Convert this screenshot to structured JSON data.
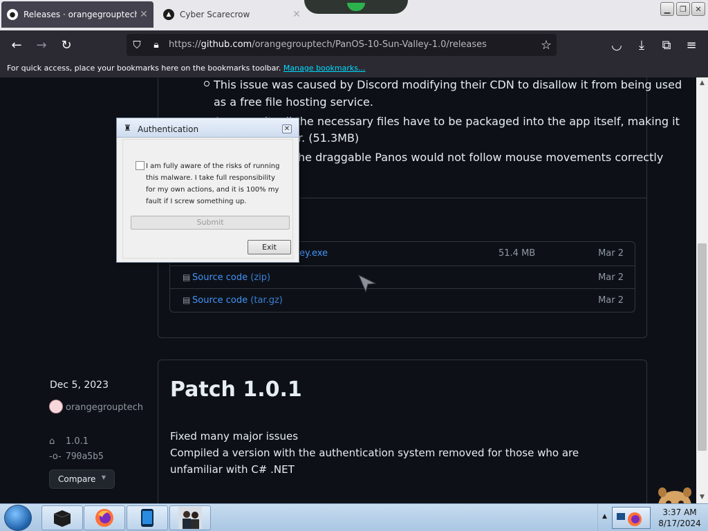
{
  "browser": {
    "tabs": [
      {
        "title": "Releases · orangegrouptech/Pa",
        "close": "✕"
      },
      {
        "title": "Cyber Scarecrow",
        "close": "✕"
      }
    ],
    "url_prefix": "https://",
    "url_host": "github.com",
    "url_path": "/orangegrouptech/PanOS-10-Sun-Valley-1.0/releases",
    "bookmarks_prompt": "For quick access, place your bookmarks here on the bookmarks toolbar.",
    "bookmarks_link": "Manage bookmarks..."
  },
  "release_prev": {
    "bullets": [
      "This issue was caused by Discord modifying their CDN to disallow it from being used",
      "as a free file hosting service.",
      "As a result, all the necessary files have to be packaged into the app itself, making it",
      "r. (51.3MB)",
      "he draggable Panos would not follow mouse movements correctly"
    ],
    "assets": [
      {
        "name": "ey.exe",
        "size": "51.4 MB",
        "date": "Mar 2"
      },
      {
        "name": "Source code",
        "suffix": "(zip)",
        "size": "",
        "date": "Mar 2"
      },
      {
        "name": "Source code",
        "suffix": "(tar.gz)",
        "size": "",
        "date": "Mar 2"
      }
    ]
  },
  "release": {
    "date": "Dec 5, 2023",
    "author": "orangegrouptech",
    "tag": "1.0.1",
    "commit": "790a5b5",
    "compare_label": "Compare",
    "title": "Patch 1.0.1",
    "body_line1": "Fixed many major issues",
    "body_line2": "Compiled a version with the authentication system removed for those who are unfamiliar with C# .NET"
  },
  "dialog": {
    "title": "Authentication",
    "checkbox_label": "I am fully aware of the risks of running this malware. I take full responsibility for my own actions, and it is 100% my fault if I screw something up.",
    "checkbox_checked": false,
    "submit_label": "Submit",
    "exit_label": "Exit"
  },
  "taskbar": {
    "time": "3:37 AM",
    "date": "8/17/2024"
  },
  "colors": {
    "page_bg": "#0d1117",
    "link": "#4493f8",
    "accent_toolbar": "#2b2a33"
  }
}
